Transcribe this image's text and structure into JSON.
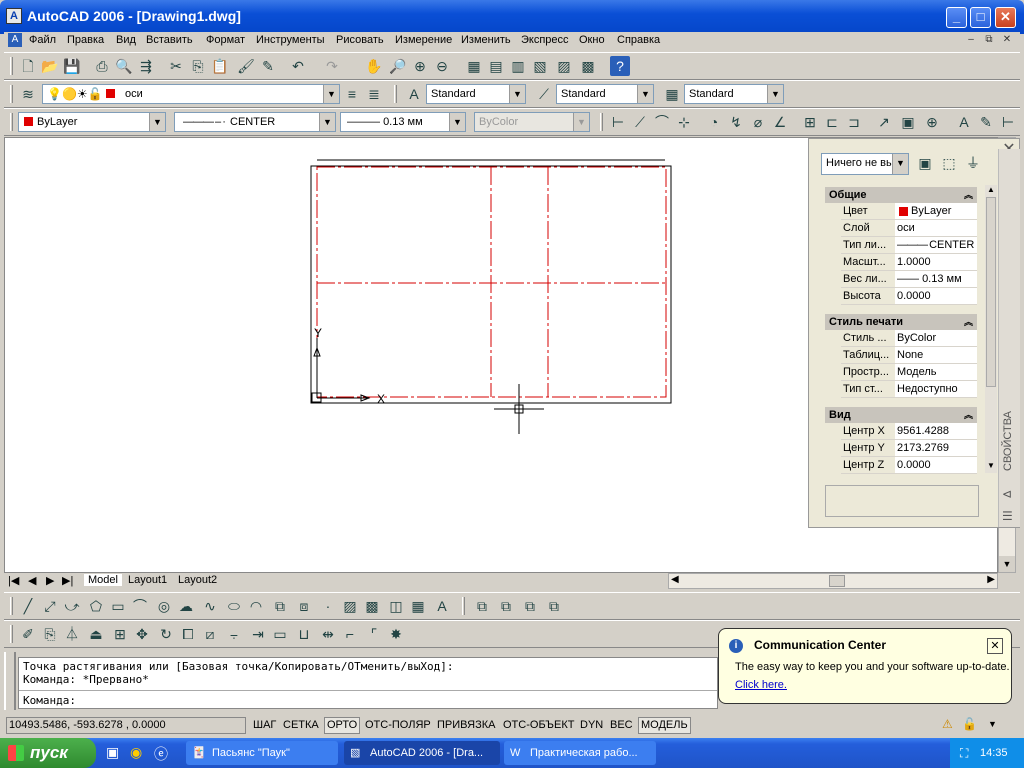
{
  "window": {
    "title": "AutoCAD 2006 - [Drawing1.dwg]",
    "app_icon": "autocad-icon"
  },
  "menu": [
    "Файл",
    "Правка",
    "Вид",
    "Вставить",
    "Формат",
    "Инструменты",
    "Рисовать",
    "Измерение",
    "Изменить",
    "Экспресс",
    "Окно",
    "Справка"
  ],
  "layers": {
    "current_layer": "оси",
    "text_style": "Standard",
    "dim_style": "Standard",
    "table_style": "Standard"
  },
  "properties_bar": {
    "color": "ByLayer",
    "linetype": "CENTER",
    "lineweight": "0.13 мм",
    "plotstyle": "ByColor"
  },
  "palette": {
    "selection": "Ничего не вы",
    "side_title": "СВОЙСТВА",
    "general": {
      "title": "Общие",
      "rows": [
        {
          "k": "Цвет",
          "v": "ByLayer"
        },
        {
          "k": "Слой",
          "v": "оси"
        },
        {
          "k": "Тип ли...",
          "v": "CENTER"
        },
        {
          "k": "Масшт...",
          "v": "1.0000"
        },
        {
          "k": "Вес ли...",
          "v": "0.13 мм"
        },
        {
          "k": "Высота",
          "v": "0.0000"
        }
      ]
    },
    "plot": {
      "title": "Стиль печати",
      "rows": [
        {
          "k": "Стиль ...",
          "v": "ByColor"
        },
        {
          "k": "Таблиц...",
          "v": "None"
        },
        {
          "k": "Простр...",
          "v": "Модель"
        },
        {
          "k": "Тип ст...",
          "v": "Недоступно"
        }
      ]
    },
    "view": {
      "title": "Вид",
      "rows": [
        {
          "k": "Центр X",
          "v": "9561.4288"
        },
        {
          "k": "Центр Y",
          "v": "2173.2769"
        },
        {
          "k": "Центр Z",
          "v": "0.0000"
        }
      ]
    }
  },
  "ucs": {
    "x": "X",
    "y": "Y"
  },
  "tabs": [
    "Model",
    "Layout1",
    "Layout2"
  ],
  "command": {
    "line1": "Точка растягивания или [Базовая точка/Копировать/ОТменить/выХод]:",
    "line2": "Команда: *Прервано*",
    "prompt": "Команда:"
  },
  "status": {
    "coords": "10493.5486, -593.6278 , 0.0000",
    "buttons": [
      {
        "label": "ШАГ",
        "on": false
      },
      {
        "label": "СЕТКА",
        "on": false
      },
      {
        "label": "ОРТО",
        "on": true
      },
      {
        "label": "ОТС-ПОЛЯР",
        "on": false
      },
      {
        "label": "ПРИВЯЗКА",
        "on": false
      },
      {
        "label": "ОТС-ОБЪЕКТ",
        "on": false
      },
      {
        "label": "DYN",
        "on": false
      },
      {
        "label": "ВЕС",
        "on": false
      },
      {
        "label": "МОДЕЛЬ",
        "on": true
      }
    ]
  },
  "balloon": {
    "title": "Communication Center",
    "text": "The easy way to keep you and your software up-to-date.",
    "link": "Click here."
  },
  "taskbar": {
    "start": "пуск",
    "tasks": [
      "Пасьянс \"Паук\"",
      "AutoCAD 2006 - [Dra...",
      "Практическая рабо..."
    ],
    "clock": "14:35"
  }
}
